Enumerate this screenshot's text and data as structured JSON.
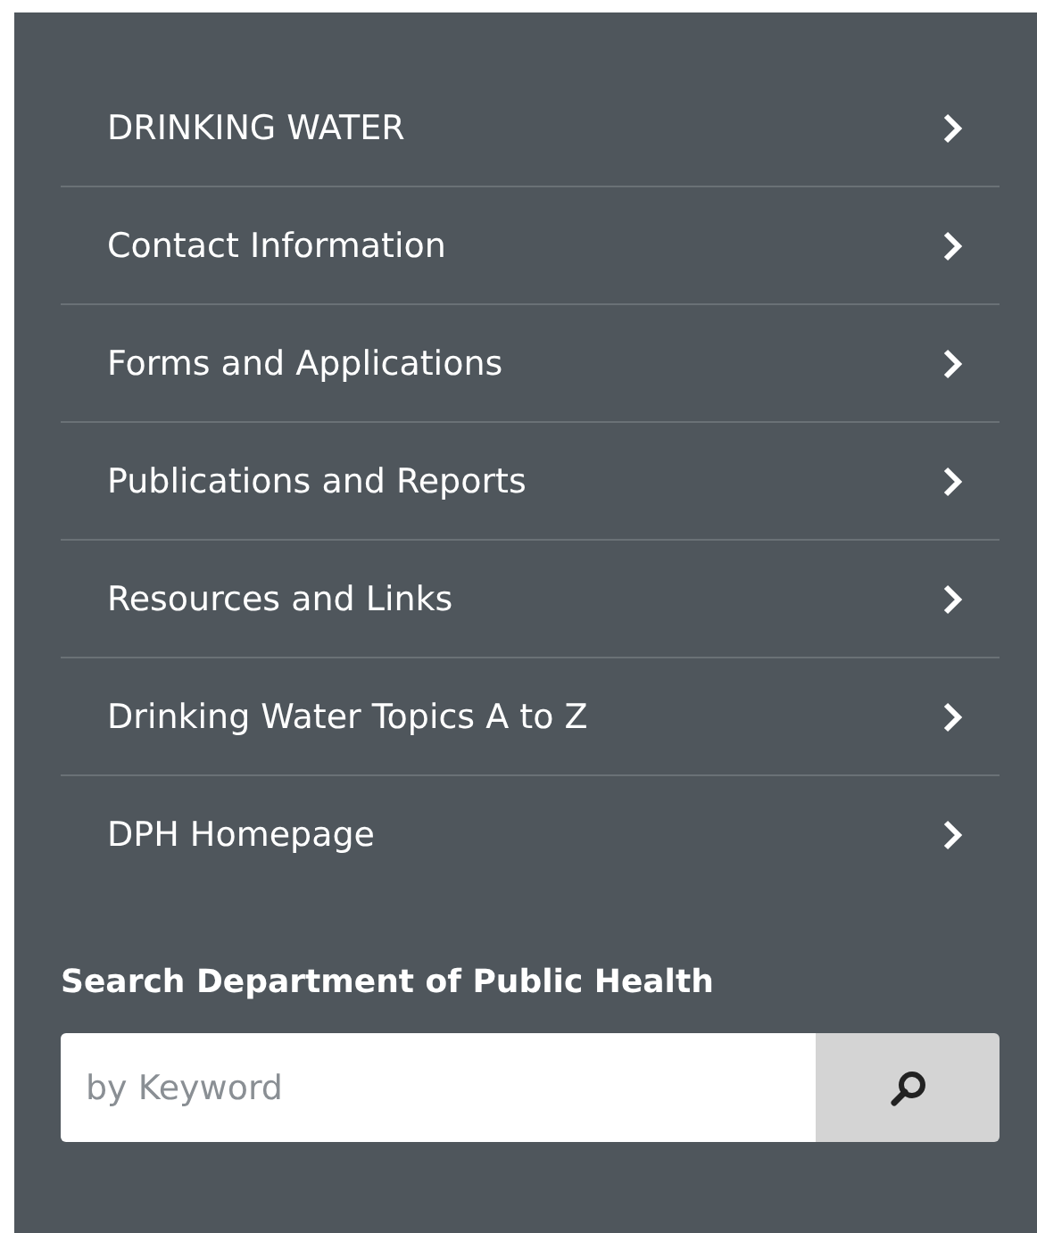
{
  "nav": {
    "items": [
      {
        "label": "DRINKING WATER"
      },
      {
        "label": "Contact Information"
      },
      {
        "label": "Forms and Applications"
      },
      {
        "label": "Publications and Reports"
      },
      {
        "label": "Resources and Links"
      },
      {
        "label": "Drinking Water Topics A to Z"
      },
      {
        "label": "DPH Homepage"
      }
    ]
  },
  "search": {
    "heading": "Search Department of Public Health",
    "placeholder": "by Keyword"
  }
}
